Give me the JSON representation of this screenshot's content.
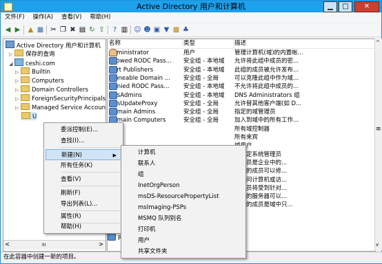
{
  "window": {
    "title": "Active Directory 用户和计算机",
    "minimize": "▁",
    "maximize": "□",
    "close": "✕"
  },
  "menubar": [
    "文件(F)",
    "操作(A)",
    "查看(V)",
    "帮助(H)"
  ],
  "tree": {
    "root": "Active Directory 用户和计算机",
    "items": [
      {
        "label": "保存的查询",
        "level": 1
      },
      {
        "label": "ceshi.com",
        "level": 1
      },
      {
        "label": "Builtin",
        "level": 2
      },
      {
        "label": "Computers",
        "level": 2
      },
      {
        "label": "Domain Controllers",
        "level": 2
      },
      {
        "label": "ForeignSecurityPrincipals",
        "level": 2
      },
      {
        "label": "Managed Service Accounts",
        "level": 2
      },
      {
        "label": "Users",
        "level": 2
      }
    ]
  },
  "list": {
    "headers": [
      "名称",
      "类型",
      "描述"
    ],
    "rows": [
      {
        "name": "Administrator",
        "type": "用户",
        "desc": "管理计算机(域)的内置帐...",
        "icon": "user"
      },
      {
        "name": "Allowed RODC Pass...",
        "type": "安全组 - 本地域",
        "desc": "允许将此组中成员的密...",
        "icon": "group"
      },
      {
        "name": "Cert Publishers",
        "type": "安全组 - 本地域",
        "desc": "此组的成员被允许发布...",
        "icon": "group"
      },
      {
        "name": "Cloneable Domain ...",
        "type": "安全组 - 全局",
        "desc": "可以克隆此组中作为域...",
        "icon": "group"
      },
      {
        "name": "Denied RODC Pass...",
        "type": "安全组 - 本地域",
        "desc": "不允许将此组中成员的...",
        "icon": "group"
      },
      {
        "name": "DnsAdmins",
        "type": "安全组 - 本地域",
        "desc": "DNS Administrators 组",
        "icon": "group"
      },
      {
        "name": "DnsUpdateProxy",
        "type": "安全组 - 全局",
        "desc": "允许替其他客户端(如 D...",
        "icon": "group"
      },
      {
        "name": "Domain Admins",
        "type": "安全组 - 全局",
        "desc": "指定的域管理员",
        "icon": "group"
      },
      {
        "name": "Domain Computers",
        "type": "安全组 - 全局",
        "desc": "加入到域中的所有工作...",
        "icon": "group"
      },
      {
        "name": "",
        "type": "",
        "desc": "所有域控制器",
        "icon": "none"
      },
      {
        "name": "",
        "type": "",
        "desc": "所有来宾",
        "icon": "none"
      },
      {
        "name": "",
        "type": "",
        "desc": "域用户",
        "icon": "none"
      },
      {
        "name": "",
        "type": "",
        "desc": "的指定系统管理员",
        "icon": "none"
      },
      {
        "name": "",
        "type": "",
        "desc": "的成员是企业中的...",
        "icon": "none"
      },
      {
        "name": "",
        "type": "",
        "desc": "组中的成员可以修...",
        "icon": "none"
      },
      {
        "name": "",
        "type": "",
        "desc": "客访问计算机或访...",
        "icon": "none"
      },
      {
        "name": "",
        "type": "",
        "desc": "的成员将受到针对...",
        "icon": "none"
      },
      {
        "name": "",
        "type": "",
        "desc": "组中的服务器可以...",
        "icon": "none"
      },
      {
        "name": "",
        "type": "",
        "desc": "组中的成员是域中只...",
        "icon": "none"
      }
    ],
    "partial_left": [
      "R",
      "R"
    ]
  },
  "context_menu": [
    {
      "label": "委派控制(E)...",
      "arrow": false
    },
    {
      "label": "查找(I)...",
      "arrow": false
    },
    {
      "label": "新建(N)",
      "arrow": true,
      "highlighted": true
    },
    {
      "label": "所有任务(K)",
      "arrow": true
    },
    {
      "label": "查看(V)",
      "arrow": true
    },
    {
      "label": "刷新(F)",
      "arrow": false
    },
    {
      "label": "导出列表(L)...",
      "arrow": false
    },
    {
      "label": "属性(R)",
      "arrow": false
    },
    {
      "label": "帮助(H)",
      "arrow": false
    }
  ],
  "submenu": [
    "计算机",
    "联系人",
    "组",
    "InetOrgPerson",
    "msDS-ResourcePropertyList",
    "msImaging-PSPs",
    "MSMQ 队列别名",
    "打印机",
    "用户",
    "共享文件夹"
  ],
  "status": "在此容器中创建一新的项目。",
  "tree_visible_partial": "U",
  "scroll": {
    "left_arrow": "<",
    "right_arrow": ">",
    "thumb": "III",
    "up": "^",
    "down": "v"
  }
}
